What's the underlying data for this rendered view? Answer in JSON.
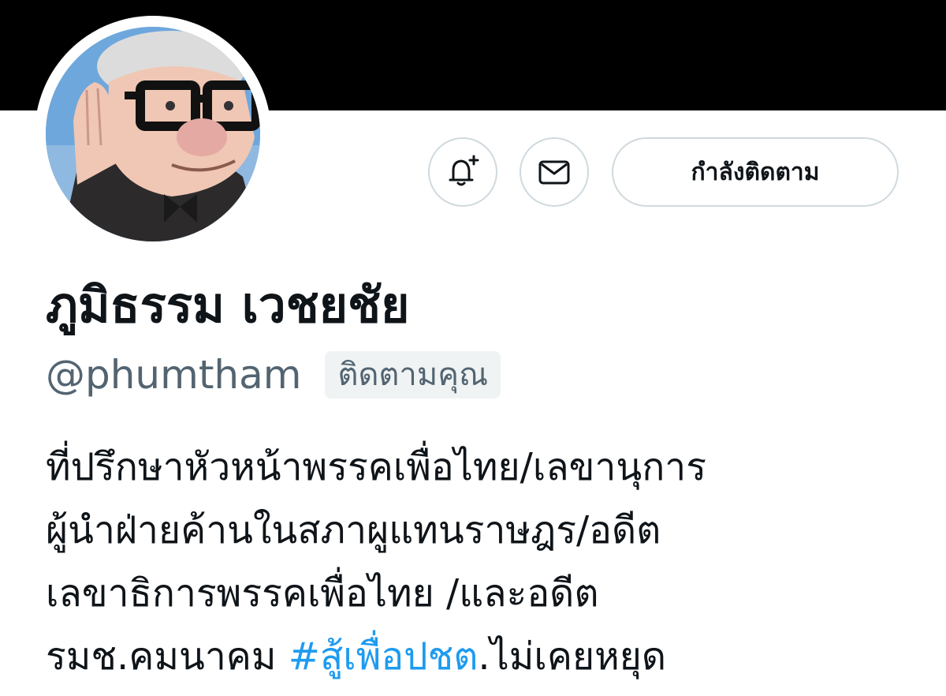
{
  "profile": {
    "display_name": "ภูมิธรรม เวชยชัย",
    "handle": "@phumtham",
    "follows_you_badge": "ติดตามคุณ",
    "avatar_icon": "user-avatar-icon"
  },
  "actions": {
    "notify_icon": "bell-plus-icon",
    "message_icon": "envelope-icon",
    "following_label": "กำลังติดตาม"
  },
  "bio": {
    "line1": "ที่ปรึกษาหัวหน้าพรรคเพื่อไทย/เลขานุการ",
    "line2": "ผู้นำฝ่ายค้านในสภาผูแทนราษฎร/อดีต",
    "line3": "เลขาธิการพรรคเพื่อไทย /และอดีต",
    "line4_prefix": "รมช.คมนาคม ",
    "line4_hashtag": "#สู้เพื่อปชต",
    "line4_suffix": ".ไม่เคยหยุด"
  },
  "colors": {
    "banner": "#000000",
    "hashtag": "#1d9bf0",
    "secondary_text": "#536471",
    "border": "#cfd9de"
  }
}
